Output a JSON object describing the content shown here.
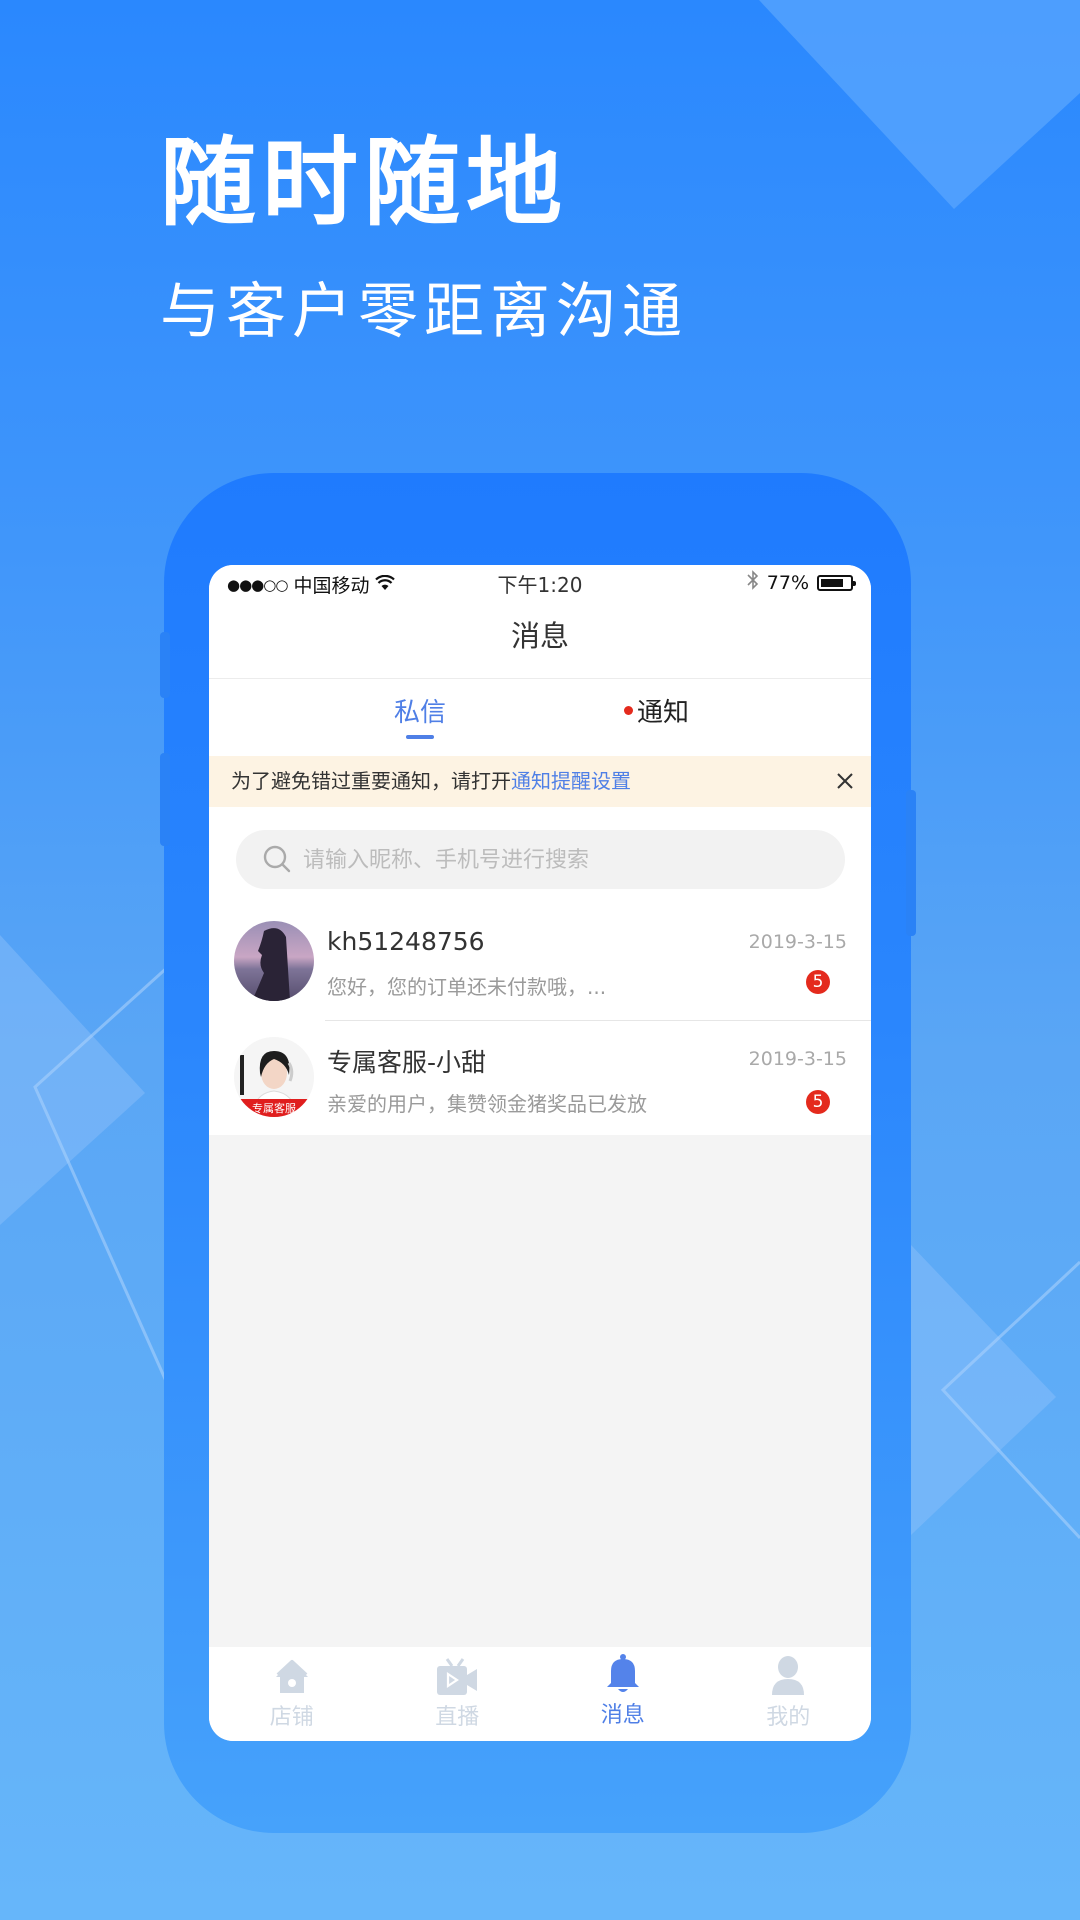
{
  "hero": {
    "title": "随时随地",
    "subtitle": "与客户零距离沟通"
  },
  "status_bar": {
    "signal": "●●●○○",
    "carrier": "中国移动",
    "wifi_icon": "wifi-icon",
    "time": "下午1:20",
    "bluetooth_icon": "bluetooth-icon",
    "battery_percent": "77%",
    "battery_level": 0.77
  },
  "header": {
    "title": "消息"
  },
  "tabs": [
    {
      "label": "私信",
      "active": true
    },
    {
      "label": "通知",
      "active": false,
      "has_red_dot": true
    }
  ],
  "notice_banner": {
    "text": "为了避免错过重要通知，请打开",
    "link": "通知提醒设置",
    "close_icon": "close-icon"
  },
  "search": {
    "placeholder": "请输入昵称、手机号进行搜索",
    "value": ""
  },
  "conversations": [
    {
      "name": "kh51248756",
      "preview": "您好，您的订单还未付款哦，...",
      "date": "2019-3-15",
      "unread": "5",
      "avatar": "woman-silhouette-avatar"
    },
    {
      "name": "专属客服-小甜",
      "preview": "亲爱的用户，集赞领金猪奖品已发放",
      "date": "2019-3-15",
      "unread": "5",
      "avatar": "customer-service-avatar",
      "avatar_badge": "专属客服"
    }
  ],
  "tabbar": [
    {
      "label": "店铺",
      "icon": "home-icon",
      "active": false
    },
    {
      "label": "直播",
      "icon": "live-tv-icon",
      "active": false
    },
    {
      "label": "消息",
      "icon": "bell-icon",
      "active": true
    },
    {
      "label": "我的",
      "icon": "user-icon",
      "active": false
    }
  ],
  "colors": {
    "accent": "#4f7fe6",
    "badge_red": "#e42a1d",
    "banner_bg": "#fdf3e3",
    "inactive_icon": "#cfd8e3",
    "phone_frame": "#1f7bfe"
  }
}
